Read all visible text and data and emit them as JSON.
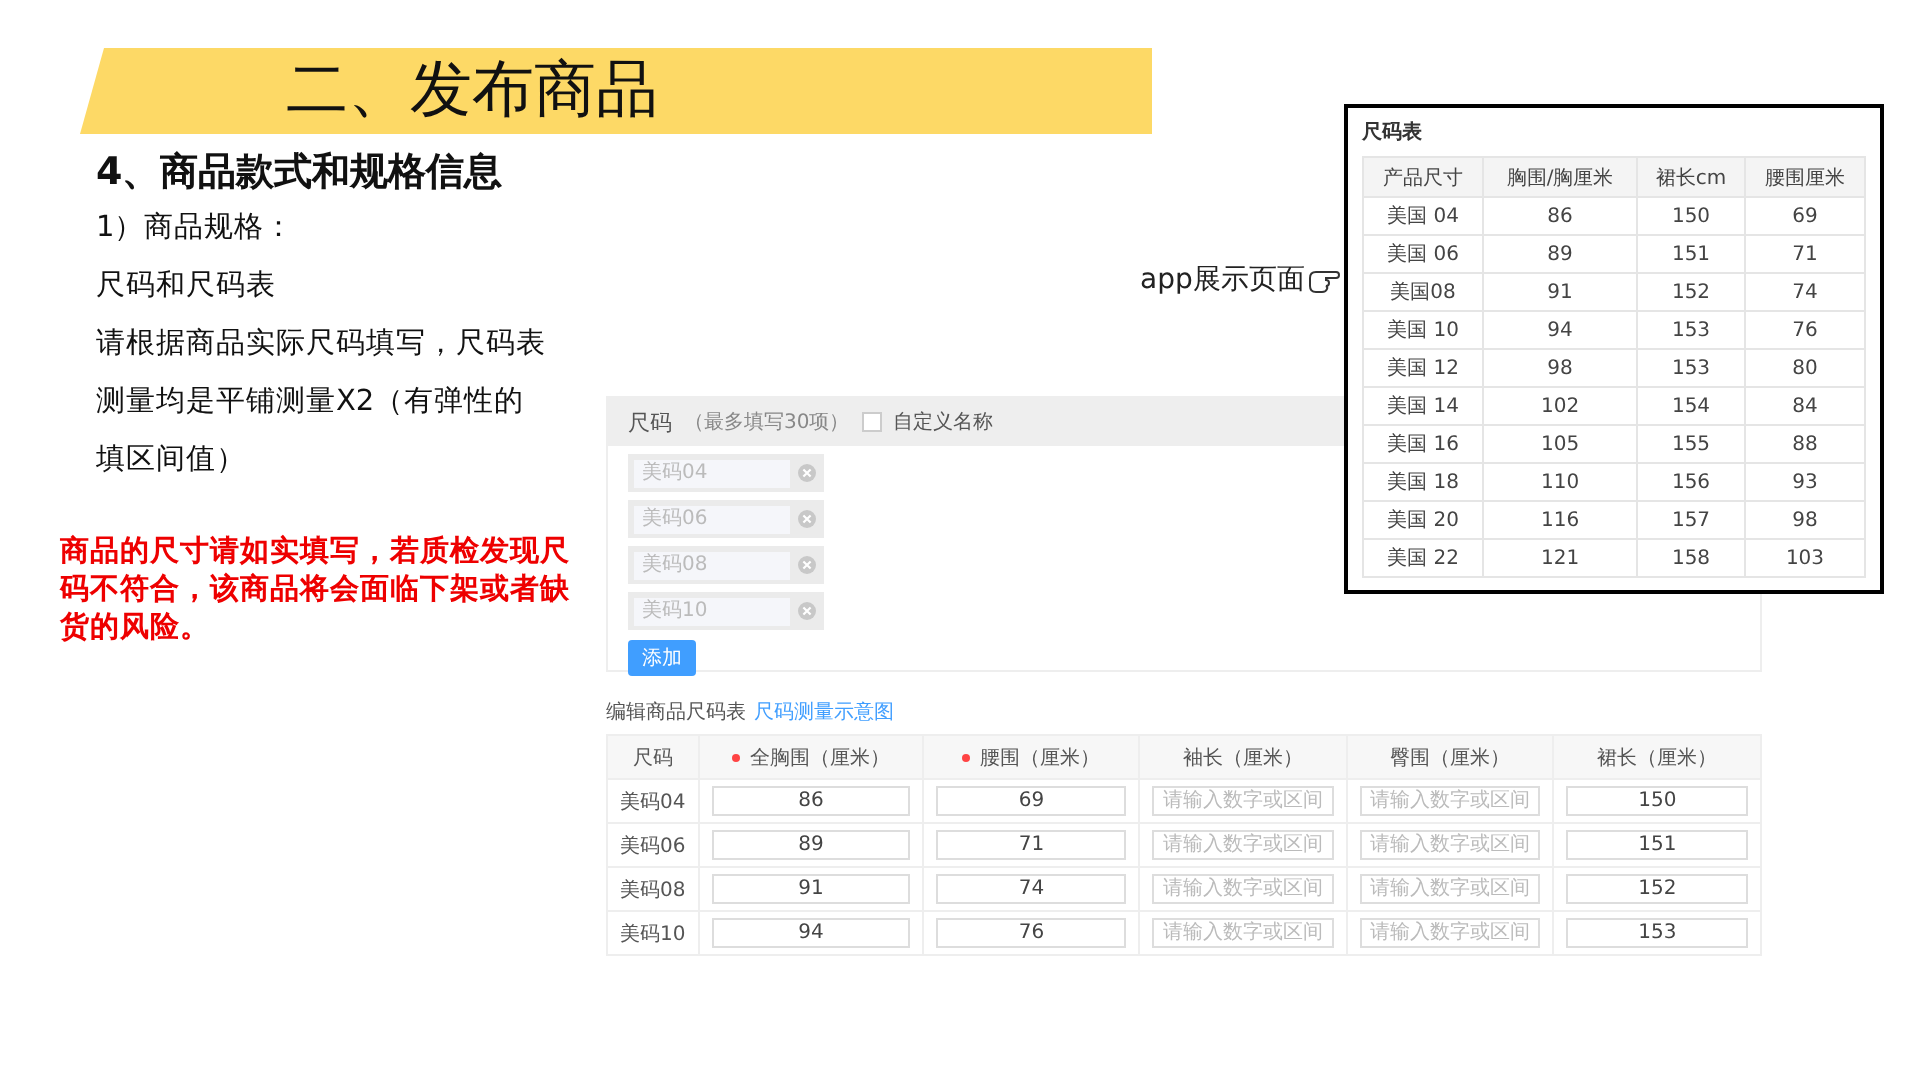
{
  "title": "二、发布商品",
  "heading": "4、商品款式和规格信息",
  "sub_heading": "1）商品规格：",
  "lines": [
    "尺码和尺码表",
    "请根据商品实际尺码填写，尺码表",
    "测量均是平铺测量X2（有弹性的",
    "填区间值）"
  ],
  "warning": "商品的尺寸请如实填写，若质检发现尺码不符合，该商品将会面临下架或者缺货的风险。",
  "app_label": "app展示页面",
  "size_form": {
    "label": "尺码",
    "hint": "（最多填写30项）",
    "custom_name": {
      "label": "自定义名称",
      "checked": false
    },
    "sizes": [
      {
        "placeholder": "美码04"
      },
      {
        "placeholder": "美码06"
      },
      {
        "placeholder": "美码08"
      },
      {
        "placeholder": "美码10"
      }
    ],
    "add_button": "添加"
  },
  "edit_table": {
    "title": "编辑商品尺码表",
    "link": "尺码测量示意图",
    "columns": [
      {
        "label": "尺码",
        "required": false
      },
      {
        "label": "全胸围（厘米）",
        "required": true
      },
      {
        "label": "腰围（厘米）",
        "required": true
      },
      {
        "label": "袖长（厘米）",
        "required": false
      },
      {
        "label": "臀围（厘米）",
        "required": false
      },
      {
        "label": "裙长（厘米）",
        "required": false
      }
    ],
    "rows": [
      {
        "cells": [
          {
            "text": "美码04"
          },
          {
            "value": "86"
          },
          {
            "value": "69"
          },
          {
            "placeholder": "请输入数字或区间"
          },
          {
            "placeholder": "请输入数字或区间"
          },
          {
            "value": "150"
          }
        ]
      },
      {
        "cells": [
          {
            "text": "美码06"
          },
          {
            "value": "89"
          },
          {
            "value": "71"
          },
          {
            "placeholder": "请输入数字或区间"
          },
          {
            "placeholder": "请输入数字或区间"
          },
          {
            "value": "151"
          }
        ]
      },
      {
        "cells": [
          {
            "text": "美码08"
          },
          {
            "value": "91"
          },
          {
            "value": "74"
          },
          {
            "placeholder": "请输入数字或区间"
          },
          {
            "placeholder": "请输入数字或区间"
          },
          {
            "value": "152"
          }
        ]
      },
      {
        "cells": [
          {
            "text": "美码10"
          },
          {
            "value": "94"
          },
          {
            "value": "76"
          },
          {
            "placeholder": "请输入数字或区间"
          },
          {
            "placeholder": "请输入数字或区间"
          },
          {
            "value": "153"
          }
        ]
      }
    ]
  },
  "size_chart": {
    "title": "尺码表",
    "columns": [
      "产品尺寸",
      "胸围/胸厘米",
      "裙长cm",
      "腰围厘米"
    ],
    "rows": [
      [
        "美国 04",
        "86",
        "150",
        "69"
      ],
      [
        "美国 06",
        "89",
        "151",
        "71"
      ],
      [
        "美国08",
        "91",
        "152",
        "74"
      ],
      [
        "美国 10",
        "94",
        "153",
        "76"
      ],
      [
        "美国 12",
        "98",
        "153",
        "80"
      ],
      [
        "美国 14",
        "102",
        "154",
        "84"
      ],
      [
        "美国 16",
        "105",
        "155",
        "88"
      ],
      [
        "美国 18",
        "110",
        "156",
        "93"
      ],
      [
        "美国 20",
        "116",
        "157",
        "98"
      ],
      [
        "美国 22",
        "121",
        "158",
        "103"
      ]
    ]
  }
}
